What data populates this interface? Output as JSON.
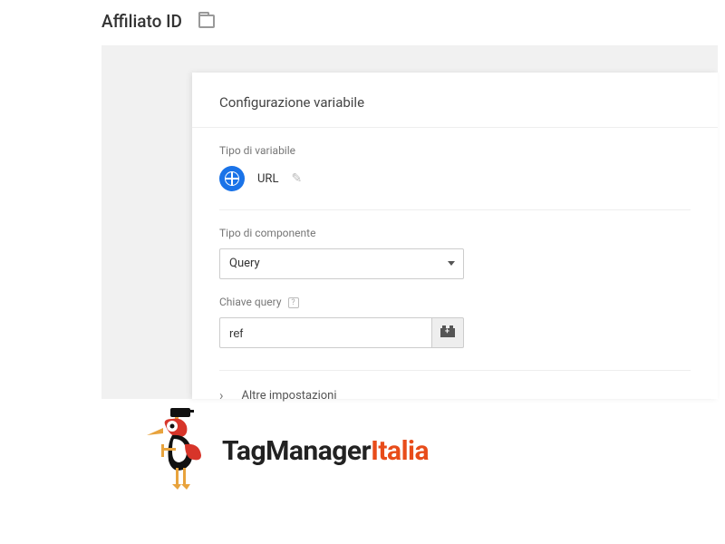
{
  "header": {
    "title": "Affiliato ID"
  },
  "panel": {
    "title": "Configurazione variabile",
    "variable_type_label": "Tipo di variabile",
    "variable_type_value": "URL",
    "component_type_label": "Tipo di componente",
    "component_type_value": "Query",
    "query_key_label": "Chiave query",
    "query_key_value": "ref",
    "more_settings": "Altre impostazioni"
  },
  "logo": {
    "part1": "TagManager",
    "part2": "Italia"
  },
  "icons": {
    "folder": "folder-icon",
    "globe": "globe-icon",
    "pencil": "pencil-icon",
    "help": "?",
    "brick": "brick-icon",
    "chevron": "›"
  }
}
